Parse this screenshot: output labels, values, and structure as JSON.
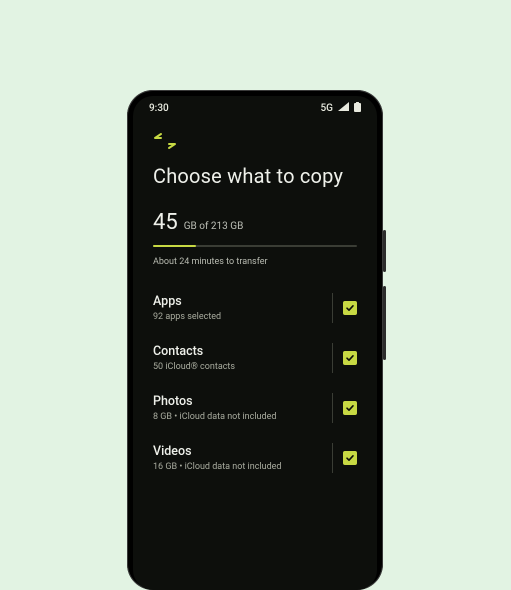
{
  "statusbar": {
    "time": "9:30",
    "network": "5G"
  },
  "page": {
    "title": "Choose what to copy"
  },
  "storage": {
    "used_number": "45",
    "rest": "GB of 213 GB",
    "progress_percent": 21,
    "eta": "About 24 minutes to transfer"
  },
  "items": [
    {
      "title": "Apps",
      "subtitle": "92 apps selected",
      "checked": true
    },
    {
      "title": "Contacts",
      "subtitle": "50 iCloud® contacts",
      "checked": true
    },
    {
      "title": "Photos",
      "subtitle": "8 GB • iCloud data not included",
      "checked": true
    },
    {
      "title": "Videos",
      "subtitle": "16 GB • iCloud data not included",
      "checked": true
    }
  ],
  "colors": {
    "accent": "#c7d943"
  }
}
